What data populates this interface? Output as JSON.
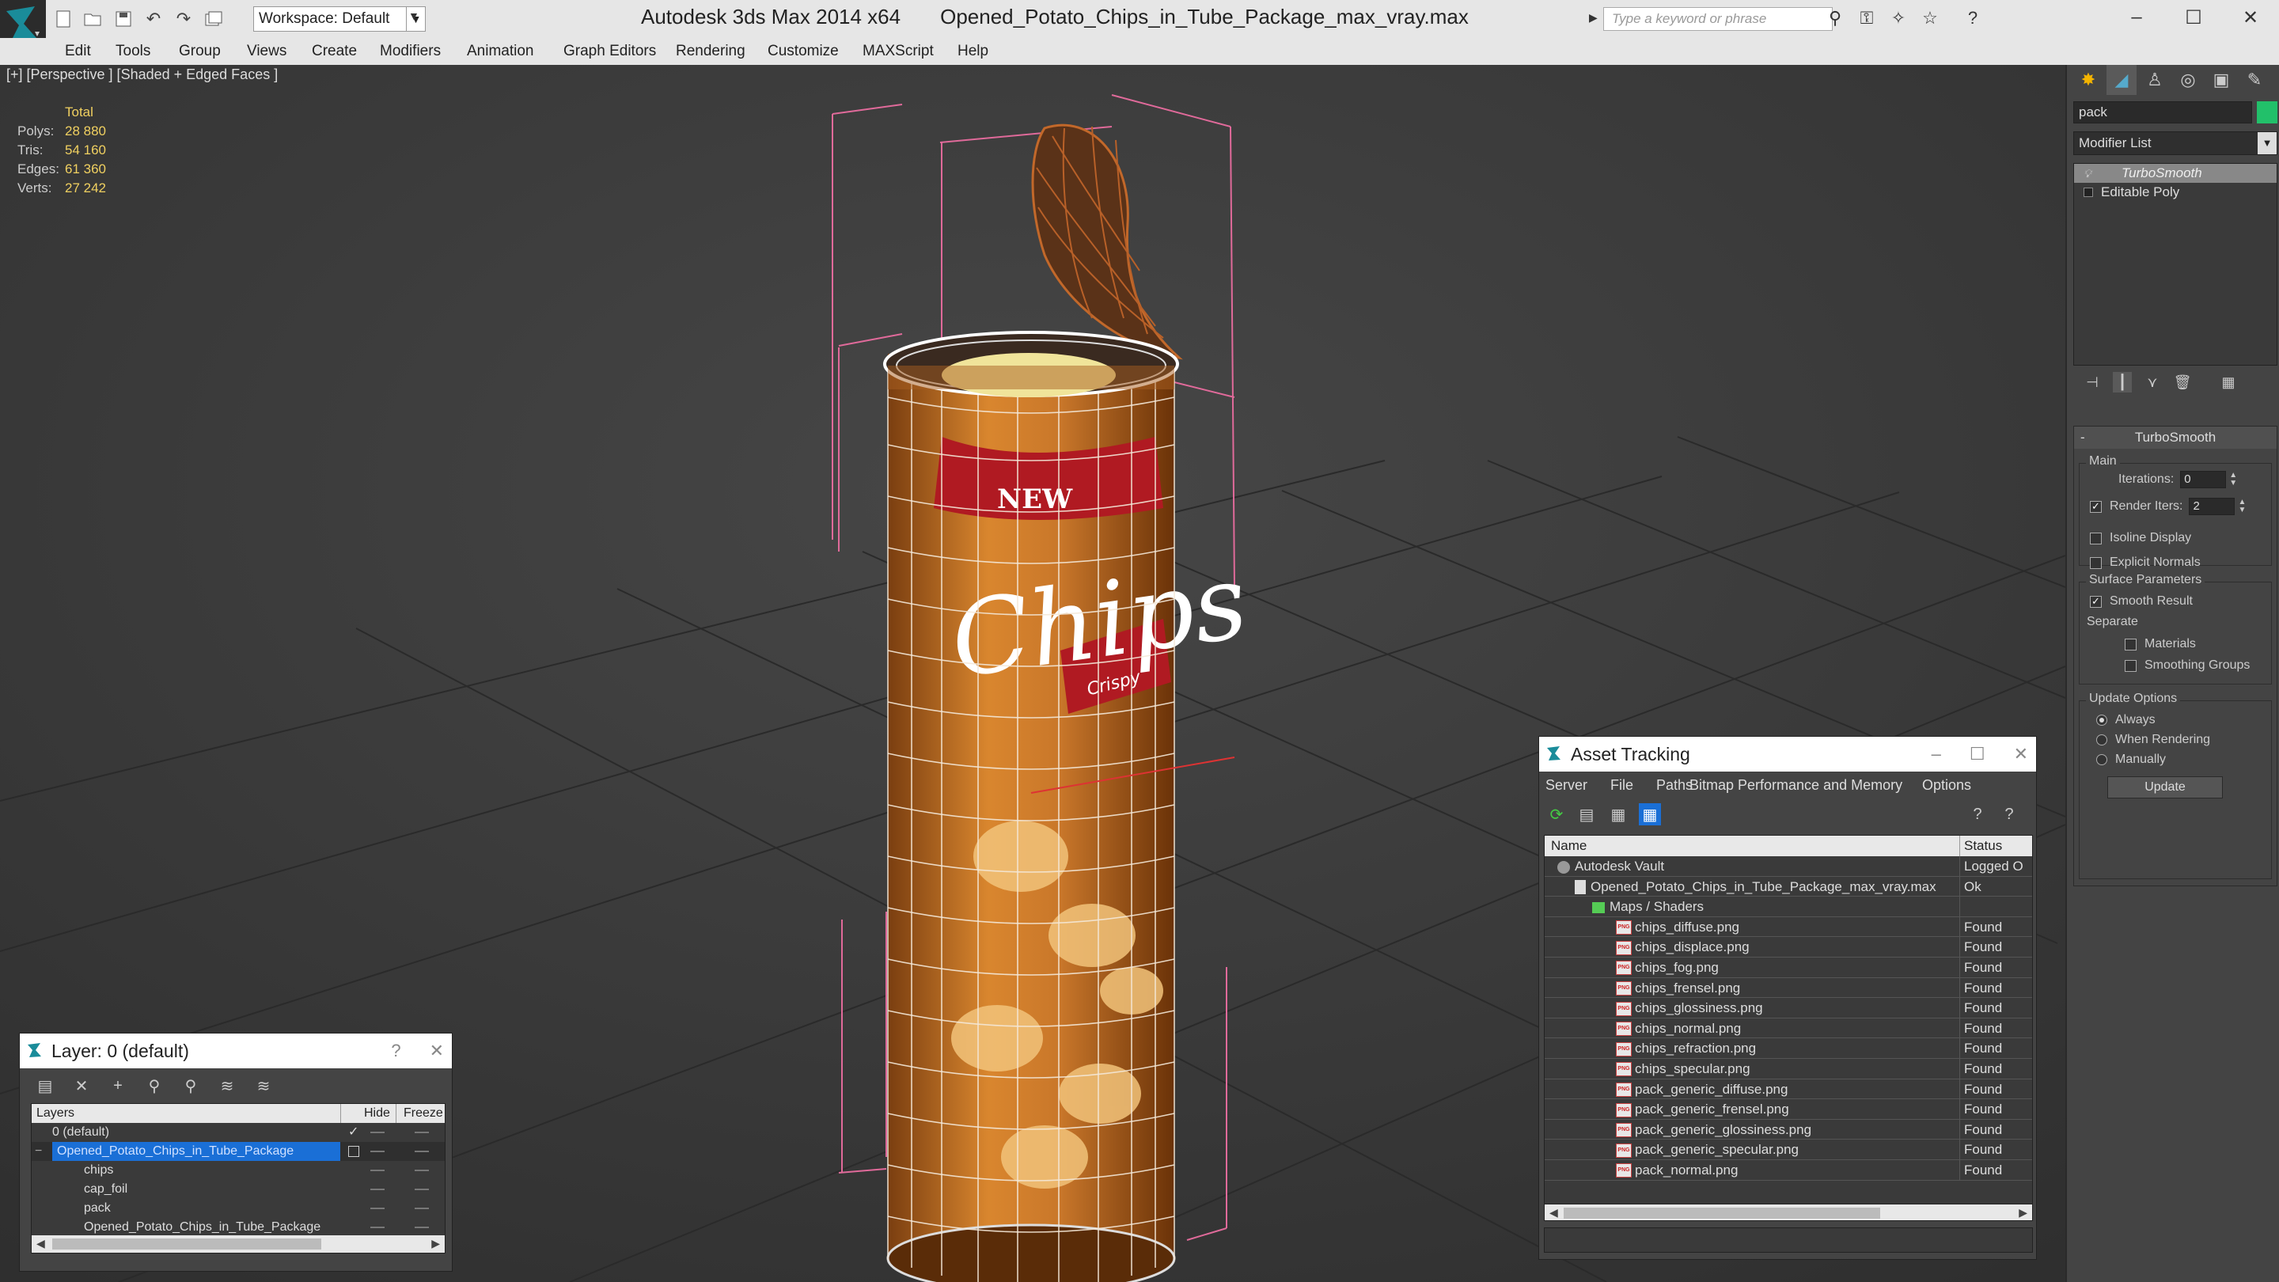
{
  "window": {
    "app_name": "Autodesk 3ds Max  2014 x64",
    "file_name": "Opened_Potato_Chips_in_Tube_Package_max_vray.max"
  },
  "toolbar": {
    "workspace_label": "Workspace: Default",
    "search_placeholder": "Type a keyword or phrase"
  },
  "menu": [
    "Edit",
    "Tools",
    "Group",
    "Views",
    "Create",
    "Modifiers",
    "Animation",
    "Graph Editors",
    "Rendering",
    "Customize",
    "MAXScript",
    "Help"
  ],
  "viewport": {
    "label": "[+] [Perspective ] [Shaded + Edged Faces ]",
    "stats": {
      "header": "Total",
      "rows": [
        {
          "key": "Polys:",
          "value": "28 880"
        },
        {
          "key": "Tris:",
          "value": "54 160"
        },
        {
          "key": "Edges:",
          "value": "61 360"
        },
        {
          "key": "Verts:",
          "value": "27 242"
        }
      ]
    },
    "label_text": {
      "brand": "NEW",
      "main": "Chips",
      "tag": "Crispy"
    }
  },
  "command_panel": {
    "object_name": "pack",
    "modifier_list": "Modifier List",
    "stack": [
      "TurboSmooth",
      "Editable Poly"
    ],
    "rollout_title": "TurboSmooth",
    "main_group": "Main",
    "iterations_label": "Iterations:",
    "iterations_value": "0",
    "render_iters_label": "Render Iters:",
    "render_iters_value": "2",
    "isoline_display": "Isoline Display",
    "explicit_normals": "Explicit Normals",
    "surface_group": "Surface Parameters",
    "smooth_result": "Smooth Result",
    "separate_label": "Separate",
    "materials": "Materials",
    "smoothing_groups": "Smoothing Groups",
    "update_group": "Update Options",
    "always": "Always",
    "when_rendering": "When Rendering",
    "manually": "Manually",
    "update_button": "Update"
  },
  "layer_dialog": {
    "title": "Layer: 0 (default)",
    "help": "?",
    "col_layers": "Layers",
    "col_hide": "Hide",
    "col_freeze": "Freeze",
    "rows": [
      {
        "name": "0 (default)",
        "indent": 0
      },
      {
        "name": "Opened_Potato_Chips_in_Tube_Package",
        "indent": 0
      },
      {
        "name": "chips",
        "indent": 1
      },
      {
        "name": "cap_foil",
        "indent": 1
      },
      {
        "name": "pack",
        "indent": 1
      },
      {
        "name": "Opened_Potato_Chips_in_Tube_Package",
        "indent": 1
      }
    ]
  },
  "asset_dialog": {
    "title": "Asset Tracking",
    "menu": [
      "Server",
      "File",
      "Paths",
      "Bitmap Performance and Memory",
      "Options"
    ],
    "col_name": "Name",
    "col_status": "Status",
    "rows": [
      {
        "name": "Autodesk Vault",
        "status": "Logged O",
        "level": 0,
        "kind": "vault"
      },
      {
        "name": "Opened_Potato_Chips_in_Tube_Package_max_vray.max",
        "status": "Ok",
        "level": 1,
        "kind": "max"
      },
      {
        "name": "Maps / Shaders",
        "status": "",
        "level": 2,
        "kind": "folder"
      },
      {
        "name": "chips_diffuse.png",
        "status": "Found",
        "level": 3,
        "kind": "png"
      },
      {
        "name": "chips_displace.png",
        "status": "Found",
        "level": 3,
        "kind": "png"
      },
      {
        "name": "chips_fog.png",
        "status": "Found",
        "level": 3,
        "kind": "png"
      },
      {
        "name": "chips_frensel.png",
        "status": "Found",
        "level": 3,
        "kind": "png"
      },
      {
        "name": "chips_glossiness.png",
        "status": "Found",
        "level": 3,
        "kind": "png"
      },
      {
        "name": "chips_normal.png",
        "status": "Found",
        "level": 3,
        "kind": "png"
      },
      {
        "name": "chips_refraction.png",
        "status": "Found",
        "level": 3,
        "kind": "png"
      },
      {
        "name": "chips_specular.png",
        "status": "Found",
        "level": 3,
        "kind": "png"
      },
      {
        "name": "pack_generic_diffuse.png",
        "status": "Found",
        "level": 3,
        "kind": "png"
      },
      {
        "name": "pack_generic_frensel.png",
        "status": "Found",
        "level": 3,
        "kind": "png"
      },
      {
        "name": "pack_generic_glossiness.png",
        "status": "Found",
        "level": 3,
        "kind": "png"
      },
      {
        "name": "pack_generic_specular.png",
        "status": "Found",
        "level": 3,
        "kind": "png"
      },
      {
        "name": "pack_normal.png",
        "status": "Found",
        "level": 3,
        "kind": "png"
      }
    ]
  },
  "colors": {
    "selection_blue": "#1a6fd6",
    "object_color": "#22c06a",
    "stats_yellow": "#f0d060"
  }
}
